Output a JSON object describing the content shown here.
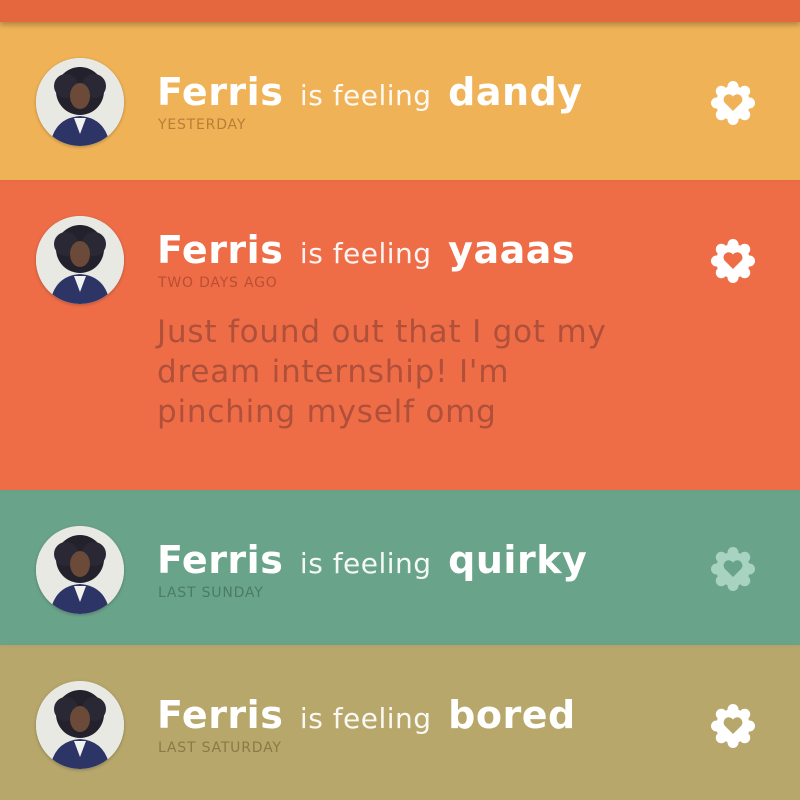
{
  "feed": {
    "posts": [
      {
        "name": "Ferris",
        "phrase": "is feeling",
        "mood": "dandy",
        "time": "YESTERDAY",
        "message": "",
        "bg_color": "#efb257",
        "time_color": "#a56f2c",
        "heart_color": "#ffffff",
        "icon": "heart-badge-icon"
      },
      {
        "name": "Ferris",
        "phrase": "is feeling",
        "mood": "yaaas",
        "time": "TWO DAYS AGO",
        "message": "Just found out that I got my dream internship! I'm pinching myself omg",
        "bg_color": "#ee6d47",
        "time_color": "#a8452c",
        "heart_color": "#ffffff",
        "icon": "heart-badge-icon"
      },
      {
        "name": "Ferris",
        "phrase": "is feeling",
        "mood": "quirky",
        "time": "LAST SUNDAY",
        "message": "",
        "bg_color": "#69a48a",
        "time_color": "#3f6e59",
        "heart_color": "#a8d3c0",
        "icon": "heart-badge-icon"
      },
      {
        "name": "Ferris",
        "phrase": "is feeling",
        "mood": "bored",
        "time": "LAST SATURDAY",
        "message": "",
        "bg_color": "#b7a76b",
        "time_color": "#7a6c3a",
        "heart_color": "#ffffff",
        "icon": "heart-badge-icon"
      }
    ]
  },
  "colors": {
    "top_strip": "#e4673e",
    "message_text": "#b0503a"
  }
}
